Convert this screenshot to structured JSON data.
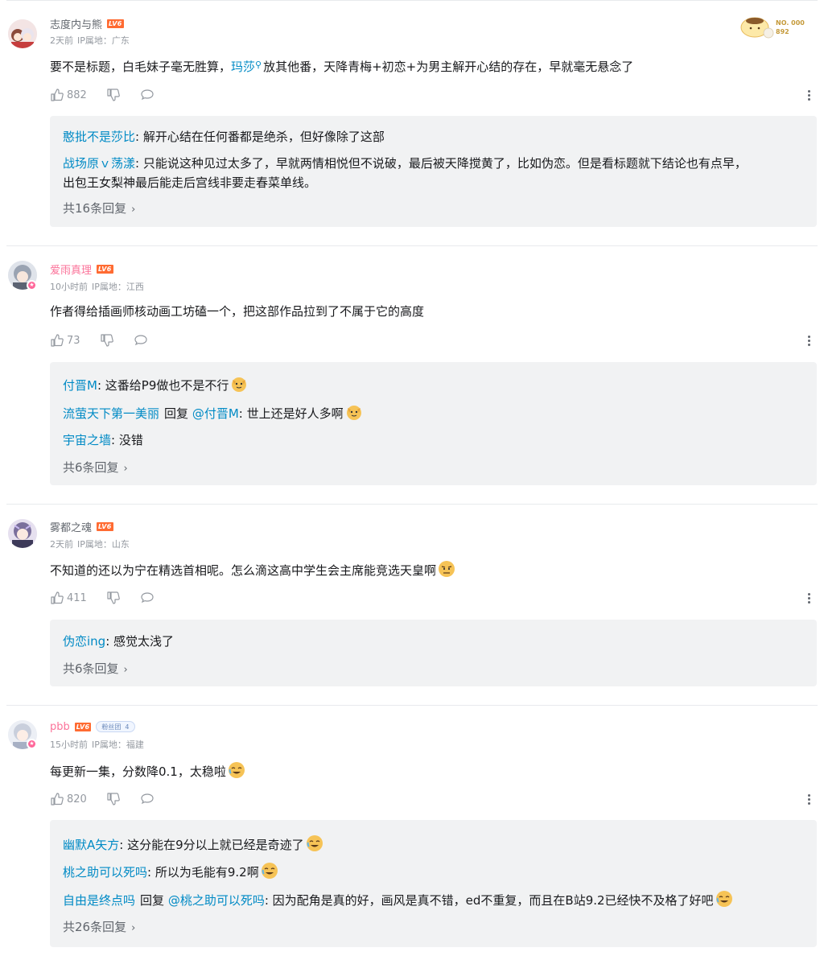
{
  "comments": [
    {
      "username": "志度内与熊",
      "level": "LV6",
      "time": "2天前",
      "ip": "IP属地：广东",
      "content_pre": "要不是标题，白毛妹子毫无胜算，",
      "content_link": "玛莎",
      "content_post": "放其他番，天降青梅+初恋+为男主解开心结的存在，早就毫无悬念了",
      "likes": "882",
      "replies": [
        {
          "name": "憨批不是莎比",
          "text": ": 解开心结在任何番都是绝杀，但好像除了这部"
        },
        {
          "name": "战场原ｖ荡漾",
          "text": ": 只能说这种见过太多了，早就两情相悦但不说破，最后被天降搅黄了，比如伪恋。但是看标题就下结论也有点早，",
          "text2": "出包王女梨神最后能走后宫线非要走春菜单线。"
        }
      ],
      "more_replies": "共16条回复",
      "decoration_text": "NO. 000892"
    },
    {
      "username": "爱雨真理",
      "level": "LV6",
      "time": "10小时前",
      "ip": "IP属地：江西",
      "content": "作者得给插画师核动画工坊磕一个，把这部作品拉到了不属于它的高度",
      "likes": "73",
      "replies": [
        {
          "name": "付晋M",
          "text": ": 这番给P9做也不是不行"
        },
        {
          "name": "流萤天下第一美丽",
          "reply_word": "回复",
          "target": "@付晋M",
          "text": ": 世上还是好人多啊"
        },
        {
          "name": "宇宙之墙",
          "text": ": 没错"
        }
      ],
      "more_replies": "共6条回复"
    },
    {
      "username": "雾都之魂",
      "level": "LV6",
      "time": "2天前",
      "ip": "IP属地：山东",
      "content": "不知道的还以为宁在精选首相呢。怎么滴这高中学生会主席能竞选天皇啊",
      "likes": "411",
      "replies": [
        {
          "name": "伪恋ing",
          "text": ": 感觉太浅了"
        }
      ],
      "more_replies": "共6条回复"
    },
    {
      "username": "pbb",
      "level": "LV6",
      "fan_badge": "粉丝团",
      "fan_level": "4",
      "time": "15小时前",
      "ip": "IP属地：福建",
      "content": "每更新一集，分数降0.1，太稳啦",
      "likes": "820",
      "replies": [
        {
          "name": "幽默A矢方",
          "text": ": 这分能在9分以上就已经是奇迹了"
        },
        {
          "name": "桃之助可以死吗",
          "text": ": 所以为毛能有9.2啊"
        },
        {
          "name": "自由是终点吗",
          "reply_word": "回复",
          "target": "@桃之助可以死吗",
          "text": ": 因为配角是真的好，画风是真不错，ed不重复，而且在B站9.2已经快不及格了好吧"
        }
      ],
      "more_replies": "共26条回复"
    }
  ],
  "colors": {
    "link": "#008ac5",
    "username_pink": "#fb7299",
    "level_orange": "#ff6b32",
    "reply_bg": "#f1f2f3",
    "meta_gray": "#9499a0"
  },
  "icons": [
    "thumb-up-icon",
    "thumb-down-icon",
    "reply-bubble-icon",
    "more-vertical-icon",
    "search-icon",
    "chevron-right-icon",
    "emoji-dog-icon",
    "emoji-laugh-cry-icon",
    "emoji-annoyed-icon"
  ]
}
